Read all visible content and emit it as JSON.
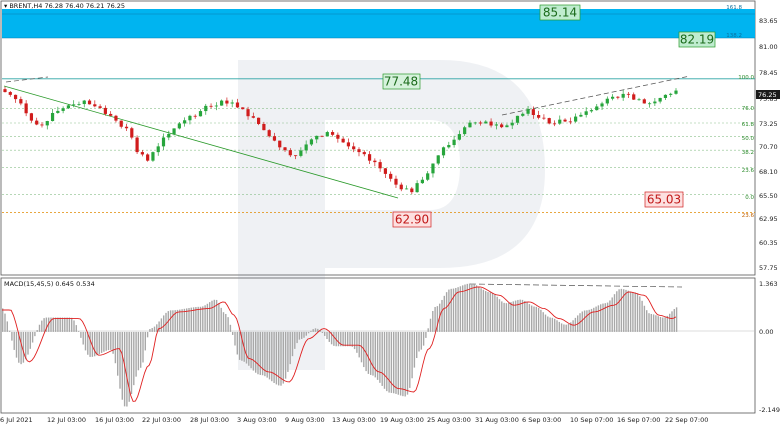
{
  "header": {
    "symbol": "BRENT,H4",
    "ohlc": "76.28 76.40 76.21 76.25"
  },
  "macd_header": "MACD(15,45,5) 0.645 0.534",
  "price_axis": [
    "83.65",
    "81.00",
    "78.45",
    "75.85",
    "73.25",
    "70.70",
    "68.10",
    "65.50",
    "62.95",
    "60.35",
    "57.75"
  ],
  "current_price": "76.25",
  "macd_axis": [
    "1.363",
    "0.00",
    "-2.149"
  ],
  "time_axis": [
    "6 Jul 2021",
    "12 Jul 03:00",
    "16 Jul 03:00",
    "22 Jul 03:00",
    "28 Jul 03:00",
    "3 Aug 03:00",
    "9 Aug 03:00",
    "13 Aug 03:00",
    "19 Aug 03:00",
    "25 Aug 03:00",
    "31 Aug 03:00",
    "6 Sep 03:00",
    "10 Sep 07:00",
    "16 Sep 07:00",
    "22 Sep 07:00"
  ],
  "fib_right_labels": [
    "161.8",
    "138.2"
  ],
  "fib_levels": [
    "100.0",
    "76.0",
    "61.8",
    "50.0",
    "38.2",
    "23.6",
    "0.0",
    "23.6"
  ],
  "callouts": {
    "top_target": "85.14",
    "second_target": "82.19",
    "resistance": "77.48",
    "retracement_target": "65.03",
    "low": "62.90"
  },
  "colors": {
    "target_zone": "#00b4f0",
    "bull_candle": "#27a53c",
    "bear_candle": "#d01c1c",
    "macd_signal": "#e02020",
    "fib_line": "#8cc08c",
    "orange_level": "#e08a00",
    "resistance_line": "#2aa3a3"
  },
  "chart_data": {
    "type": "candlestick",
    "symbol": "BRENT",
    "timeframe": "H4",
    "approx_closes": [
      75.8,
      74.9,
      73.1,
      72.6,
      73.9,
      74.4,
      74.8,
      75.2,
      74.6,
      73.8,
      73.1,
      72.3,
      69.8,
      68.9,
      70.4,
      71.7,
      72.8,
      73.6,
      74.1,
      74.6,
      75.2,
      75.0,
      74.3,
      73.4,
      72.1,
      71.0,
      70.0,
      69.4,
      70.6,
      71.5,
      71.9,
      71.2,
      70.4,
      69.8,
      68.9,
      68.1,
      67.0,
      65.9,
      65.6,
      66.9,
      68.6,
      70.3,
      71.1,
      72.4,
      72.9,
      73.0,
      72.7,
      72.6,
      73.6,
      74.3,
      73.4,
      72.8,
      73.2,
      73.0,
      73.7,
      74.2,
      74.9,
      75.6,
      75.9,
      75.3,
      74.9,
      75.1,
      75.8,
      76.25
    ],
    "ylim": [
      57.75,
      86.3
    ],
    "macd_ylim": [
      -2.149,
      1.363
    ]
  }
}
